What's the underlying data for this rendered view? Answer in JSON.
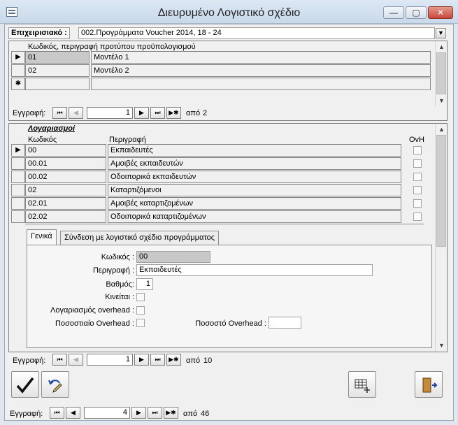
{
  "window": {
    "title": "Διευρυμένο Λογιστικό σχέδιο",
    "minimize": "—",
    "maximize": "▢",
    "close": "✕"
  },
  "header": {
    "company_label": "Επιχειρισιακό :",
    "company_value": "002.Προγράμματα Voucher 2014, 18 - 24"
  },
  "budget_templates": {
    "column_header": "Κωδικός, περιγραφή προτύπου προϋπολογισμού",
    "rows": [
      {
        "selector": "▶",
        "code": "01",
        "description": "Μοντέλο 1"
      },
      {
        "selector": "",
        "code": "02",
        "description": "Μοντέλο 2"
      },
      {
        "selector": "✱",
        "code": "",
        "description": ""
      }
    ],
    "nav": {
      "label": "Εγγραφή:",
      "current": "1",
      "of_label": "από",
      "total": "2"
    }
  },
  "accounts": {
    "section_title": "Λογαριασμοί",
    "columns": {
      "code": "Κωδικός",
      "description": "Περιγραφή",
      "ovh": "OvH"
    },
    "rows": [
      {
        "selector": "▶",
        "code": "00",
        "description": "Εκπαιδευτές"
      },
      {
        "selector": "",
        "code": "00.01",
        "description": "Αμοιβές εκπαιδευτών"
      },
      {
        "selector": "",
        "code": "00.02",
        "description": "Οδοιπορικά εκπαιδευτών"
      },
      {
        "selector": "",
        "code": "02",
        "description": "Καταρτιζόμενοι"
      },
      {
        "selector": "",
        "code": "02.01",
        "description": "Αμοιβές καταρτιζομένων"
      },
      {
        "selector": "",
        "code": "02.02",
        "description": "Οδοιπορικά καταρτιζομένων"
      }
    ],
    "tabs": [
      "Γενικά",
      "Σύνδεση με λογιστικό σχέδιο προγράμματος"
    ],
    "detail": {
      "code_label": "Κωδικός :",
      "code_value": "00",
      "description_label": "Περιγραφή :",
      "description_value": "Εκπαιδευτές",
      "level_label": "Βαθμός:",
      "level_value": "1",
      "movable_label": "Κινείται :",
      "overhead_account_label": "Λογαριασμός overhead :",
      "overhead_percent_flag_label": "Ποσοστιαίο Overhead :",
      "overhead_percent_label": "Ποσοστό Overhead :",
      "overhead_percent_value": ""
    },
    "nav": {
      "label": "Εγγραφή:",
      "current": "1",
      "of_label": "από",
      "total": "10"
    }
  },
  "main_nav": {
    "label": "Εγγραφή:",
    "current": "4",
    "of_label": "από",
    "total": "46"
  },
  "icons": {
    "first": "⏮",
    "prev": "◀",
    "next": "▶",
    "last": "⏭",
    "new": "▶✱"
  }
}
